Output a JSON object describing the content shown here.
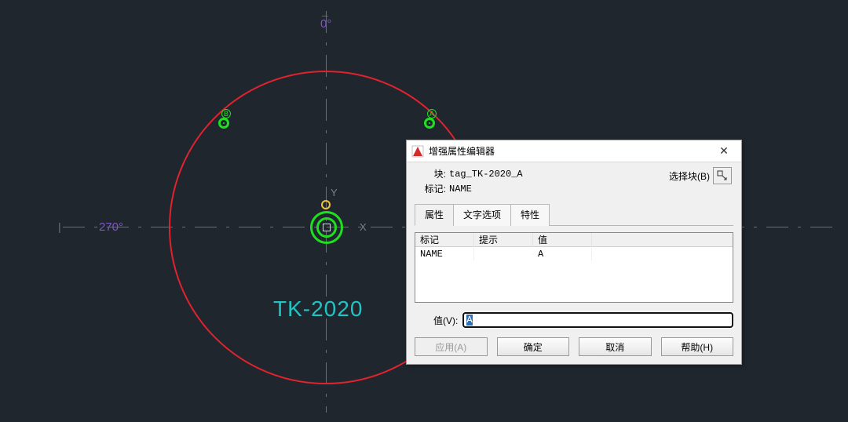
{
  "drawing": {
    "angle_top": "0°",
    "angle_left": "270°",
    "tk_label": "TK-2020",
    "axis_x": "X",
    "axis_y": "Y",
    "nozzle_a": "A",
    "nozzle_b": "B"
  },
  "dialog": {
    "title": "增强属性编辑器",
    "block_label": "块:",
    "block_value": "tag_TK-2020_A",
    "tag_label": "标记:",
    "tag_value": "NAME",
    "select_block_label": "选择块(B)",
    "tabs": {
      "attr": "属性",
      "textopt": "文字选项",
      "props": "特性"
    },
    "columns": {
      "tag": "标记",
      "prompt": "提示",
      "value": "值"
    },
    "rows": [
      {
        "tag": "NAME",
        "prompt": "",
        "value": "A"
      }
    ],
    "value_label": "值(V):",
    "value_input": "A",
    "buttons": {
      "apply": "应用(A)",
      "ok": "确定",
      "cancel": "取消",
      "help": "帮助(H)"
    }
  }
}
